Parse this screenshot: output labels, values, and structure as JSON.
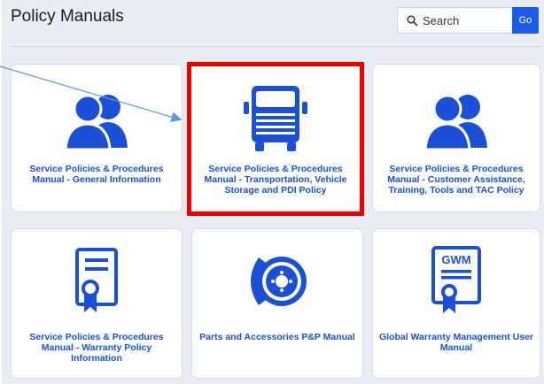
{
  "header": {
    "title": "Policy Manuals"
  },
  "search": {
    "placeholder": "Search",
    "go_label": "Go"
  },
  "cards": [
    {
      "label": "Service Policies & Procedures Manual - General Information",
      "icon": "people-icon"
    },
    {
      "label": "Service Policies & Procedures Manual - Transportation, Vehicle Storage and PDI Policy",
      "icon": "truck-icon"
    },
    {
      "label": "Service Policies & Procedures Manual - Customer Assistance, Training, Tools and TAC Policy",
      "icon": "people-icon"
    },
    {
      "label": "Service Policies & Procedures Manual - Warranty Policy Information",
      "icon": "certificate-icon"
    },
    {
      "label": "Parts and Accessories P&P Manual",
      "icon": "brake-disc-icon"
    },
    {
      "label": "Global Warranty Management User Manual",
      "icon": "gwm-document-icon"
    }
  ],
  "gwm_icon_text": "GWM",
  "colors": {
    "icon_blue": "#1a4fd6",
    "go_button": "#1a5ce6",
    "highlight_border": "#ee0000",
    "panel_bg": "#e8eef4"
  }
}
